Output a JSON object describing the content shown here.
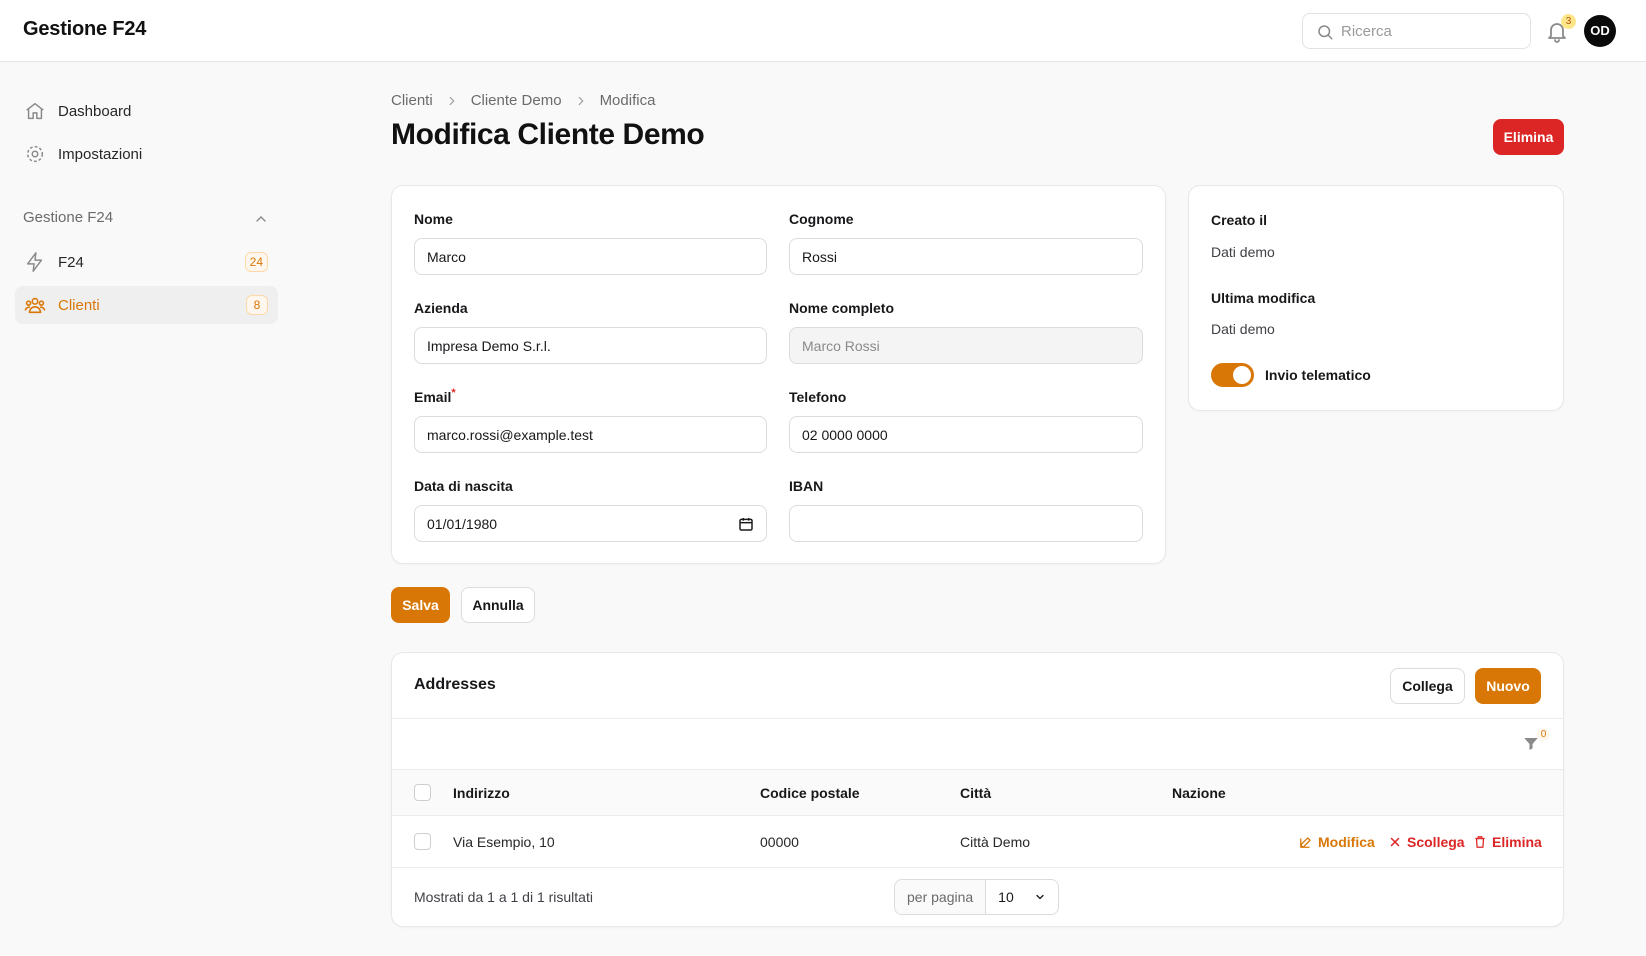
{
  "app": {
    "brand": "Gestione F24"
  },
  "header": {
    "search_placeholder": "Ricerca",
    "notifications_count": "3",
    "avatar_initials": "OD"
  },
  "sidebar": {
    "top_items": [
      {
        "label": "Dashboard",
        "icon": "home-icon"
      },
      {
        "label": "Impostazioni",
        "icon": "gear-icon"
      }
    ],
    "group": {
      "label": "Gestione F24",
      "expanded": true
    },
    "group_items": [
      {
        "label": "F24",
        "icon": "bolt-icon",
        "badge": "24",
        "active": false
      },
      {
        "label": "Clienti",
        "icon": "users-icon",
        "badge": "8",
        "active": true
      }
    ]
  },
  "breadcrumbs": [
    "Clienti",
    "Cliente Demo",
    "Modifica"
  ],
  "page": {
    "title": "Modifica Cliente Demo",
    "delete_label": "Elimina"
  },
  "form": {
    "nome": {
      "label": "Nome",
      "value": "Marco"
    },
    "cognome": {
      "label": "Cognome",
      "value": "Rossi"
    },
    "azienda": {
      "label": "Azienda",
      "value": "Impresa Demo S.r.l."
    },
    "nome_completo": {
      "label": "Nome completo",
      "value": "Marco Rossi"
    },
    "email": {
      "label": "Email",
      "required_mark": "*",
      "value": "marco.rossi@example.test"
    },
    "telefono": {
      "label": "Telefono",
      "value": "02 0000 0000"
    },
    "data_nascita": {
      "label": "Data di nascita",
      "value": "01/01/1980"
    },
    "iban": {
      "label": "IBAN",
      "value": ""
    }
  },
  "meta": {
    "created_label": "Creato il",
    "created_value": "Dati demo",
    "modified_label": "Ultima modifica",
    "modified_value": "Dati demo",
    "toggle_label": "Invio telematico",
    "toggle_on": true
  },
  "actions": {
    "save": "Salva",
    "cancel": "Annulla"
  },
  "addresses": {
    "title": "Addresses",
    "attach_label": "Collega",
    "new_label": "Nuovo",
    "filter_count": "0",
    "columns": [
      "Indirizzo",
      "Codice postale",
      "Città",
      "Nazione"
    ],
    "rows": [
      {
        "indirizzo": "Via Esempio, 10",
        "cap": "00000",
        "citta": "Città Demo",
        "nazione": ""
      }
    ],
    "row_actions": {
      "edit": "Modifica",
      "detach": "Scollega",
      "delete": "Elimina"
    },
    "footer": {
      "summary": "Mostrati da 1 a 1 di 1 risultati",
      "per_page_label": "per pagina",
      "per_page_value": "10"
    }
  },
  "colors": {
    "accent": "#d97706",
    "danger": "#dc2626"
  }
}
